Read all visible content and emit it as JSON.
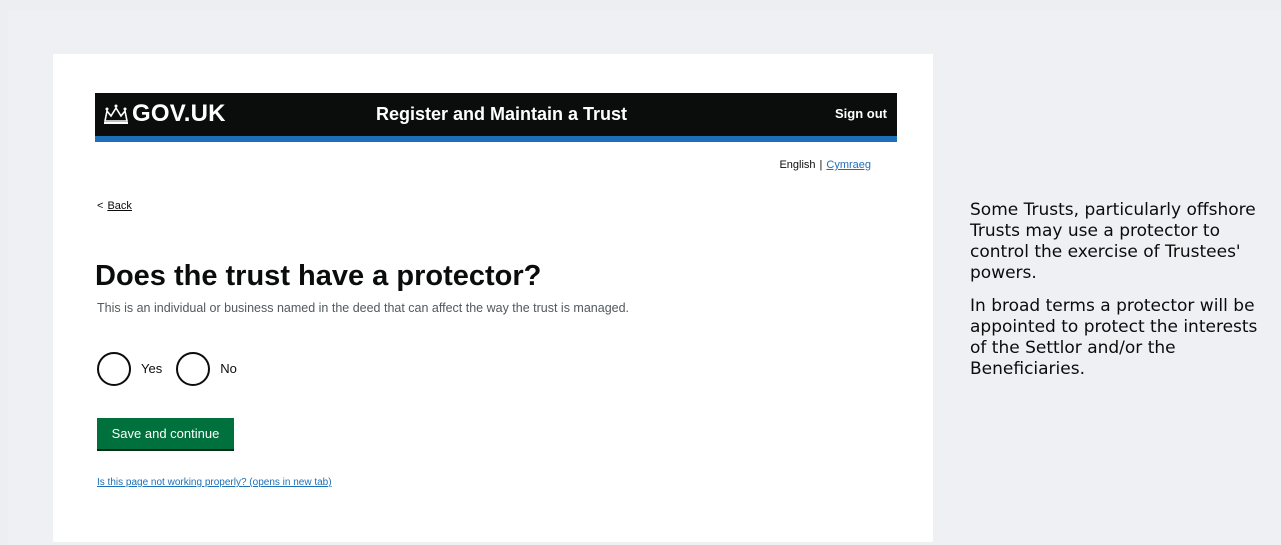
{
  "header": {
    "logo_text": "GOV.UK",
    "service_name": "Register and Maintain a Trust",
    "sign_out": "Sign out"
  },
  "language": {
    "current": "English",
    "separator": "|",
    "other": "Cymraeg"
  },
  "back_link": {
    "chevron": "<",
    "label": "Back"
  },
  "page": {
    "heading": "Does the trust have a protector?",
    "hint": "This is an individual or business named in the deed that can affect the way the trust is managed."
  },
  "radios": [
    {
      "label": "Yes",
      "selected": false
    },
    {
      "label": "No",
      "selected": false
    }
  ],
  "save_button": "Save and continue",
  "report_link": "Is this page not working properly? (opens in new tab)",
  "side_note": {
    "paragraph_1": "Some Trusts, particularly offshore Trusts may use a protector to control the exercise of Trustees' powers.",
    "paragraph_2": "In broad terms a protector will be appointed to protect the interests of the Settlor and/or the Beneficiaries."
  },
  "colors": {
    "header_bg": "#0b0c0c",
    "accent_bar": "#1d70b8",
    "button_green": "#00703c",
    "link_blue": "#1d70b8"
  },
  "icons": {
    "crown": "crown-icon"
  }
}
